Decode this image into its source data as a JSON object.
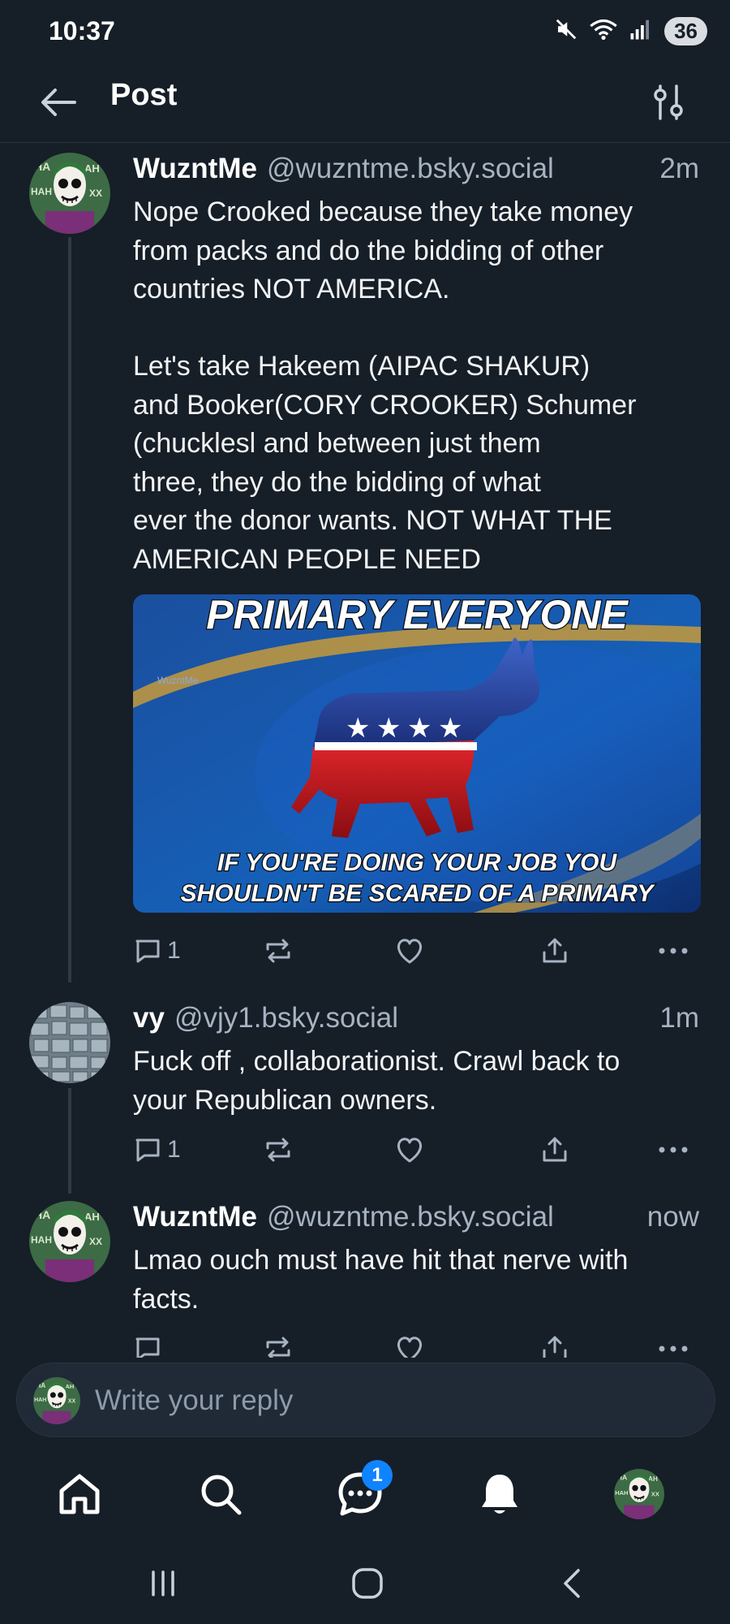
{
  "status_bar": {
    "time": "10:37",
    "battery": "36",
    "icons": [
      "mute-icon",
      "wifi-icon",
      "signal-icon"
    ]
  },
  "header": {
    "title": "Post",
    "back_icon": "arrow-left-icon",
    "filter_icon": "sliders-icon"
  },
  "posts": [
    {
      "author": "WuzntMe",
      "handle": "@wuzntme.bsky.social",
      "time": "2m",
      "text": "Nope Crooked because they take money\nfrom packs and do the bidding of other\ncountries NOT AMERICA.\n\nLet's take Hakeem (AIPAC SHAKUR)\nand Booker(CORY CROOKER) Schumer\n(chucklesl and between just them\nthree, they do the bidding of what\never the donor wants. NOT WHAT THE\nAMERICAN PEOPLE NEED",
      "image": {
        "headline": "PRIMARY EVERYONE",
        "caption_line1": "IF YOU'RE DOING YOUR JOB YOU",
        "caption_line2": "SHOULDN'T BE SCARED OF A PRIMARY",
        "watermark": "WuzntMe"
      },
      "reply_count": "1"
    },
    {
      "author": "vy",
      "handle": "@vjy1.bsky.social",
      "time": "1m",
      "text": "Fuck off , collaborationist. Crawl back to\nyour Republican owners.",
      "reply_count": "1"
    },
    {
      "author": "WuzntMe",
      "handle": "@wuzntme.bsky.social",
      "time": "now",
      "text": "Lmao ouch must have hit that nerve with\nfacts.",
      "reply_count": ""
    }
  ],
  "reply_bar": {
    "placeholder": "Write your reply"
  },
  "bottom_nav": {
    "items": [
      "home-icon",
      "search-icon",
      "chat-icon",
      "bell-icon",
      "profile-avatar"
    ],
    "chat_badge": "1"
  },
  "colors": {
    "background": "#161e27",
    "muted": "#a6b3c2",
    "accent": "#1083fe",
    "thread_line": "#2e3a47"
  }
}
